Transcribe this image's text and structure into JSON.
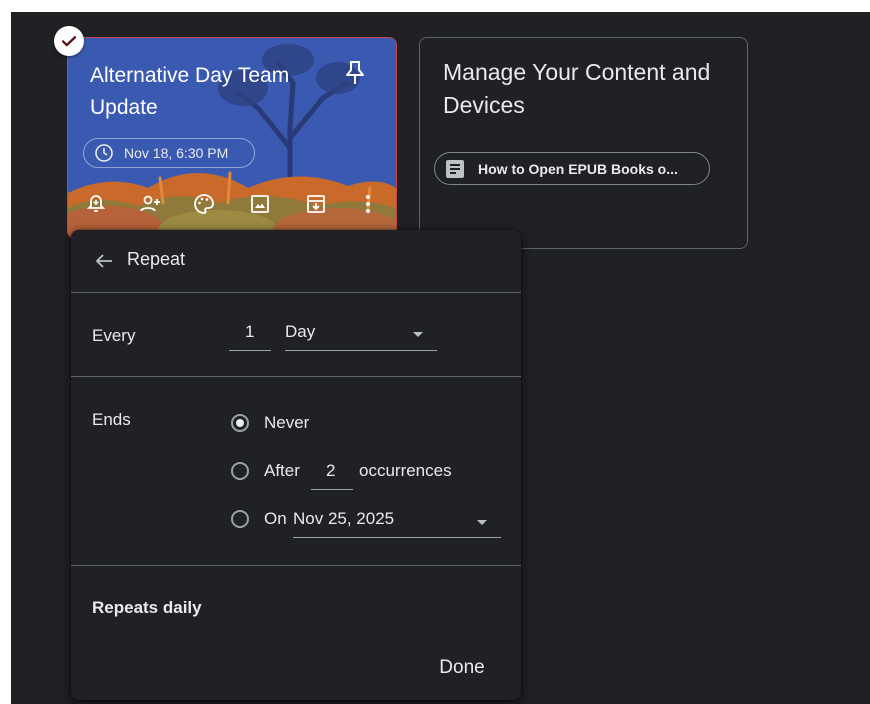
{
  "note_card_1": {
    "title": "Alternative Day Team Update",
    "reminder_chip": "Nov 18, 6:30 PM",
    "toolbar_icons": [
      "remind-me-icon",
      "collaborator-icon",
      "palette-icon",
      "image-icon",
      "archive-icon",
      "more-icon"
    ]
  },
  "note_card_2": {
    "title": "Manage Your Content and Devices",
    "link_chip": "How to Open EPUB Books o..."
  },
  "repeat_dialog": {
    "title": "Repeat",
    "every_label": "Every",
    "every_count": "1",
    "every_unit": "Day",
    "ends_label": "Ends",
    "options": {
      "never": "Never",
      "after_prefix": "After",
      "after_count": "2",
      "after_suffix": "occurrences",
      "on_prefix": "On",
      "on_date": "Nov 25, 2025"
    },
    "selected_option": "never",
    "summary": "Repeats daily",
    "done_label": "Done"
  },
  "colors": {
    "background": "#202124",
    "card1_bg": "#3958b0",
    "card1_border": "#c5464c",
    "text": "#e8eaed",
    "divider": "#5f6368"
  }
}
